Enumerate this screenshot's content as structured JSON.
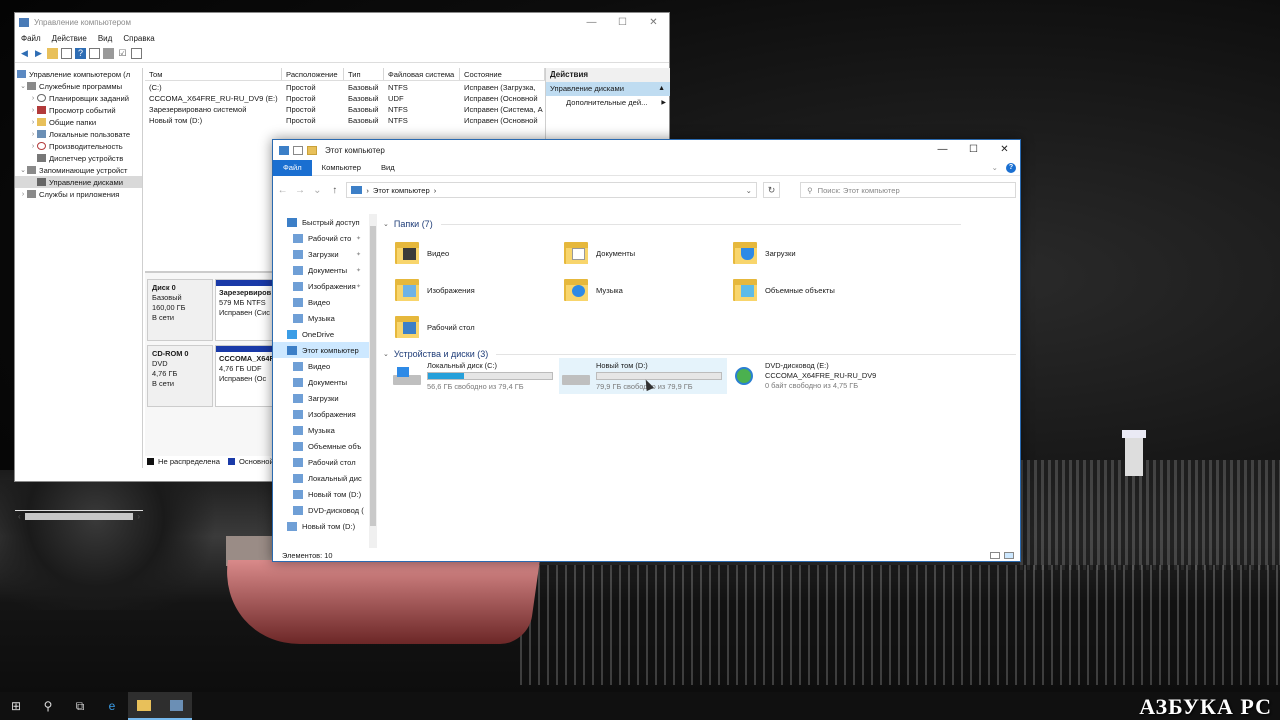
{
  "computer_management": {
    "title": "Управление компьютером",
    "menu": [
      "Файл",
      "Действие",
      "Вид",
      "Справка"
    ],
    "tree": [
      {
        "label": "Управление компьютером (л",
        "indent": 0
      },
      {
        "label": "Служебные программы",
        "indent": 1
      },
      {
        "label": "Планировщик заданий",
        "indent": 2
      },
      {
        "label": "Просмотр событий",
        "indent": 2
      },
      {
        "label": "Общие папки",
        "indent": 2
      },
      {
        "label": "Локальные пользовате",
        "indent": 2
      },
      {
        "label": "Производительность",
        "indent": 2
      },
      {
        "label": "Диспетчер устройств",
        "indent": 2
      },
      {
        "label": "Запоминающие устройст",
        "indent": 1
      },
      {
        "label": "Управление дисками",
        "indent": 2
      },
      {
        "label": "Службы и приложения",
        "indent": 1
      }
    ],
    "volume_columns": [
      "Том",
      "Расположение",
      "Тип",
      "Файловая система",
      "Состояние"
    ],
    "volumes": [
      [
        "(C:)",
        "Простой",
        "Базовый",
        "NTFS",
        "Исправен (Загрузка,"
      ],
      [
        "CCCOMA_X64FRE_RU-RU_DV9 (E:)",
        "Простой",
        "Базовый",
        "UDF",
        "Исправен (Основной"
      ],
      [
        "Зарезервировано системой",
        "Простой",
        "Базовый",
        "NTFS",
        "Исправен (Система, А"
      ],
      [
        "Новый том (D:)",
        "Простой",
        "Базовый",
        "NTFS",
        "Исправен (Основной"
      ]
    ],
    "actions": {
      "header": "Действия",
      "section": "Управление дисками",
      "item": "Дополнительные дей..."
    },
    "disks": [
      {
        "name": "Диск 0",
        "type": "Базовый",
        "size": "160,00 ГБ",
        "status": "В сети",
        "part_name": "Зарезервиров",
        "part_size": "579 МБ NTFS",
        "part_status": "Исправен (Сис"
      },
      {
        "name": "CD-ROM 0",
        "type": "DVD",
        "size": "4,76 ГБ",
        "status": "В сети",
        "part_name": "CCCOMA_X64F",
        "part_size": "4,76 ГБ UDF",
        "part_status": "Исправен (Ос"
      }
    ],
    "legend": [
      "Не распределена",
      "Основной"
    ]
  },
  "explorer": {
    "title": "Этот компьютер",
    "ribbon_tabs": [
      "Файл",
      "Компьютер",
      "Вид"
    ],
    "address": "Этот компьютер",
    "search_placeholder": "Поиск: Этот компьютер",
    "nav": [
      {
        "label": "Быстрый доступ",
        "top": true,
        "pinned": false
      },
      {
        "label": "Рабочий сто",
        "top": false,
        "pinned": true
      },
      {
        "label": "Загрузки",
        "top": false,
        "pinned": true
      },
      {
        "label": "Документы",
        "top": false,
        "pinned": true
      },
      {
        "label": "Изображения",
        "top": false,
        "pinned": true
      },
      {
        "label": "Видео",
        "top": false,
        "pinned": false
      },
      {
        "label": "Музыка",
        "top": false,
        "pinned": false
      },
      {
        "label": "OneDrive",
        "top": true,
        "pinned": false
      },
      {
        "label": "Этот компьютер",
        "top": true,
        "pinned": false
      },
      {
        "label": "Видео",
        "top": false,
        "pinned": false
      },
      {
        "label": "Документы",
        "top": false,
        "pinned": false
      },
      {
        "label": "Загрузки",
        "top": false,
        "pinned": false
      },
      {
        "label": "Изображения",
        "top": false,
        "pinned": false
      },
      {
        "label": "Музыка",
        "top": false,
        "pinned": false
      },
      {
        "label": "Объемные объ",
        "top": false,
        "pinned": false
      },
      {
        "label": "Рабочий стол",
        "top": false,
        "pinned": false
      },
      {
        "label": "Локальный дис",
        "top": false,
        "pinned": false
      },
      {
        "label": "Новый том (D:)",
        "top": false,
        "pinned": false
      },
      {
        "label": "DVD-дисковод (",
        "top": false,
        "pinned": false
      },
      {
        "label": "Новый том (D:)",
        "top": true,
        "pinned": false
      }
    ],
    "folders_header": "Папки (7)",
    "folders": [
      "Видео",
      "Документы",
      "Загрузки",
      "Изображения",
      "Музыка",
      "Объемные объекты",
      "Рабочий стол"
    ],
    "devices_header": "Устройства и диски (3)",
    "drives": [
      {
        "name": "Локальный диск (C:)",
        "free": "56,6 ГБ свободно из 79,4 ГБ",
        "used_fraction": 0.287,
        "kind": "system"
      },
      {
        "name": "Новый том (D:)",
        "free": "79,9 ГБ свободно из 79,9 ГБ",
        "used_fraction": 0.0,
        "kind": "hdd"
      },
      {
        "name": "DVD-дисковод (E:)",
        "label": "CCCOMA_X64FRE_RU-RU_DV9",
        "free": "0 байт свободно из 4,75 ГБ",
        "kind": "dvd"
      }
    ],
    "status": "Элементов: 10"
  },
  "watermark": "АЗБУКА РС"
}
